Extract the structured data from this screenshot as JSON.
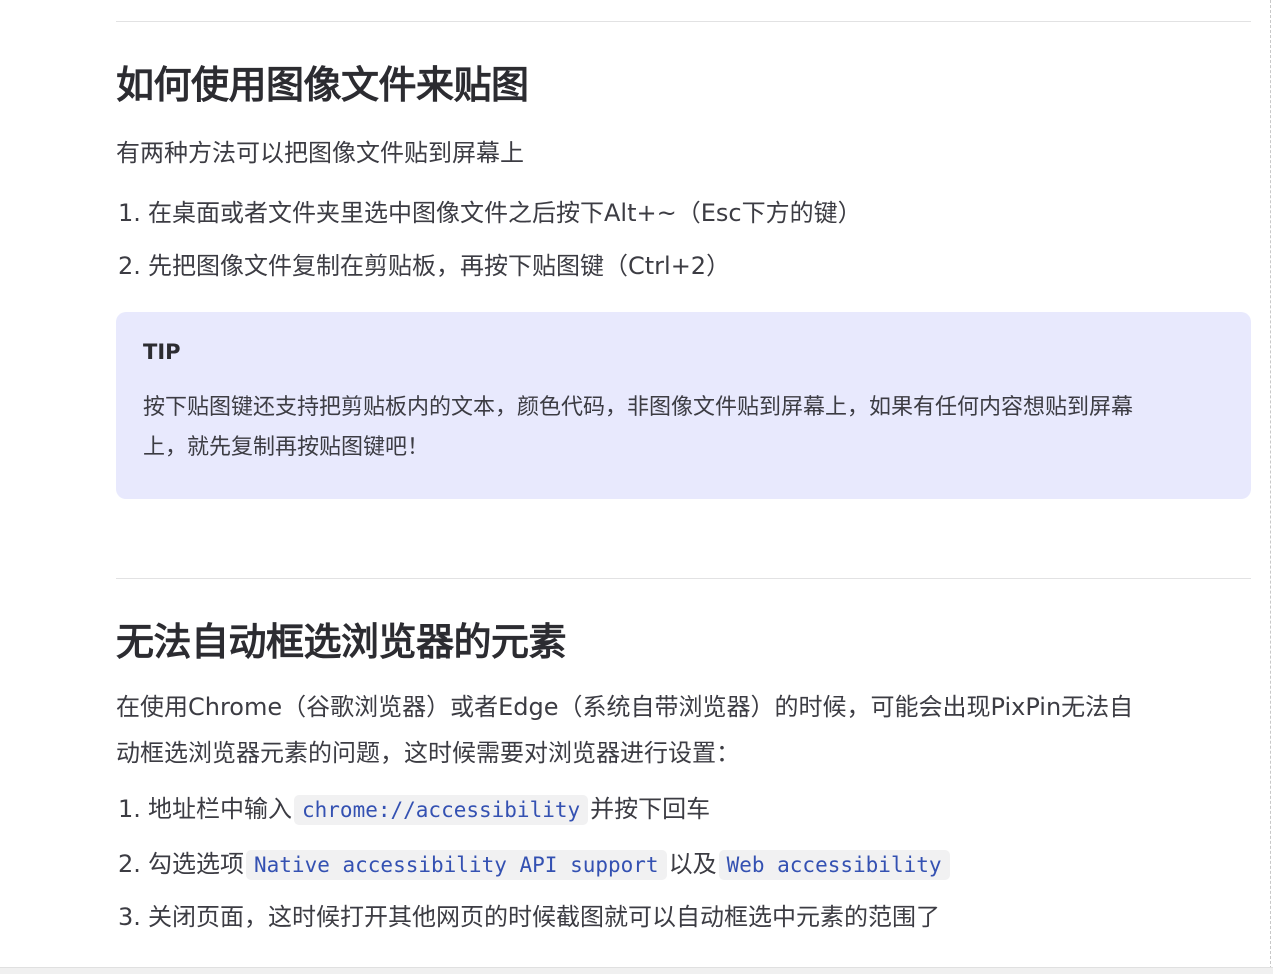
{
  "section1": {
    "title": "如何使用图像文件来贴图",
    "intro": "有两种方法可以把图像文件贴到屏幕上",
    "steps": [
      {
        "num": "1.",
        "text": "在桌面或者文件夹里选中图像文件之后按下Alt+~（Esc下方的键）"
      },
      {
        "num": "2.",
        "text": "先把图像文件复制在剪贴板，再按下贴图键（Ctrl+2）"
      }
    ],
    "tip": {
      "title": "TIP",
      "body_line1": "按下贴图键还支持把剪贴板内的文本，颜色代码，非图像文件贴到屏幕上，如果有任何内容想贴到屏幕",
      "body_line2": "上，就先复制再按贴图键吧！"
    }
  },
  "section2": {
    "title": "无法自动框选浏览器的元素",
    "intro_line1": "在使用Chrome（谷歌浏览器）或者Edge（系统自带浏览器）的时候，可能会出现PixPin无法自",
    "intro_line2": "动框选浏览器元素的问题，这时候需要对浏览器进行设置：",
    "steps": [
      {
        "num": "1.",
        "before": "地址栏中输入",
        "code": "chrome://accessibility",
        "after": "并按下回车"
      },
      {
        "num": "2.",
        "before": "勾选选项",
        "code": "Native accessibility API support",
        "middle": "以及",
        "code2": "Web accessibility"
      },
      {
        "num": "3.",
        "text": "关闭页面，这时候打开其他网页的时候截图就可以自动框选中元素的范围了"
      }
    ]
  }
}
